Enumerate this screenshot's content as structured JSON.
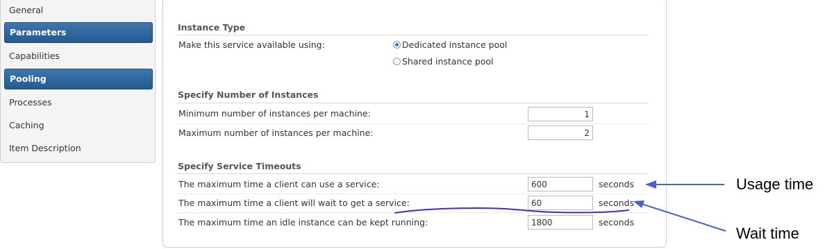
{
  "sidebar": {
    "items": [
      {
        "label": "General",
        "active": false
      },
      {
        "label": "Parameters",
        "active": true
      },
      {
        "label": "Capabilities",
        "active": false
      },
      {
        "label": "Pooling",
        "active": true
      },
      {
        "label": "Processes",
        "active": false
      },
      {
        "label": "Caching",
        "active": false
      },
      {
        "label": "Item Description",
        "active": false
      }
    ]
  },
  "instance_type": {
    "title": "Instance Type",
    "label": "Make this service available using:",
    "options": [
      {
        "label": "Dedicated instance pool",
        "checked": true
      },
      {
        "label": "Shared instance pool",
        "checked": false
      }
    ]
  },
  "instances": {
    "title": "Specify Number of Instances",
    "min_label": "Minimum number of instances per machine:",
    "min_value": "1",
    "max_label": "Maximum number of instances per machine:",
    "max_value": "2"
  },
  "timeouts": {
    "title": "Specify Service Timeouts",
    "usage_label": "The maximum time a client can use a service:",
    "usage_value": "600",
    "wait_label": "The maximum time a client will wait to get a service:",
    "wait_value": "60",
    "idle_label": "The maximum time an idle instance can be kept running:",
    "idle_value": "1800",
    "unit": "seconds"
  },
  "annotations": {
    "usage_time": "Usage time",
    "wait_time": "Wait time",
    "color": "#4a5fc9",
    "scribble_color": "#3b2bd8"
  }
}
